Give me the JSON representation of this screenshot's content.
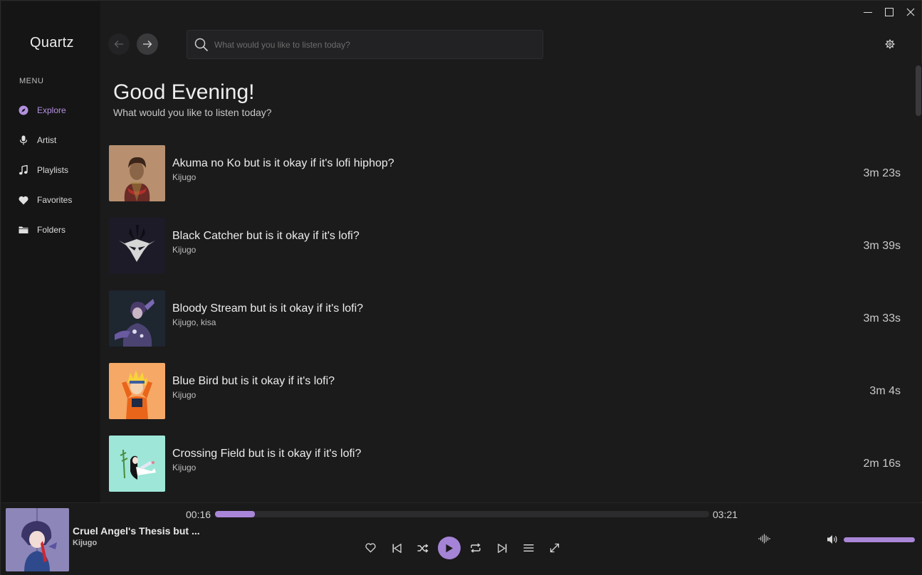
{
  "app": {
    "name": "Quartz"
  },
  "colors": {
    "accent": "#a986d8",
    "background": "#1b1b1c",
    "sidebar": "#151515"
  },
  "sidebar": {
    "menu_heading": "MENU",
    "items": [
      {
        "label": "Explore",
        "icon": "compass-icon",
        "active": true
      },
      {
        "label": "Artist",
        "icon": "microphone-icon",
        "active": false
      },
      {
        "label": "Playlists",
        "icon": "music-note-icon",
        "active": false
      },
      {
        "label": "Favorites",
        "icon": "heart-icon",
        "active": false
      },
      {
        "label": "Folders",
        "icon": "folder-icon",
        "active": false
      }
    ]
  },
  "search": {
    "placeholder": "What would you like to listen today?",
    "value": ""
  },
  "main": {
    "greeting": "Good Evening!",
    "subtitle": "What would you like to listen today?",
    "tracks": [
      {
        "title": "Akuma no Ko but is it okay if it's lofi hiphop?",
        "artist": "Kijugo",
        "duration": "3m 23s"
      },
      {
        "title": "Black Catcher but is it okay if it's lofi?",
        "artist": "Kijugo",
        "duration": "3m 39s"
      },
      {
        "title": "Bloody Stream but is it okay if it's lofi?",
        "artist": "Kijugo, kisa",
        "duration": "3m 33s"
      },
      {
        "title": "Blue Bird but is it okay if it's lofi?",
        "artist": "Kijugo",
        "duration": "3m 4s"
      },
      {
        "title": "Crossing Field but is it okay if it's lofi?",
        "artist": "Kijugo",
        "duration": "2m 16s"
      }
    ]
  },
  "player": {
    "title": "Cruel Angel's Thesis but ...",
    "artist": "Kijugo",
    "current_time": "00:16",
    "total_time": "03:21",
    "progress": 0.08,
    "volume": 1.0
  }
}
